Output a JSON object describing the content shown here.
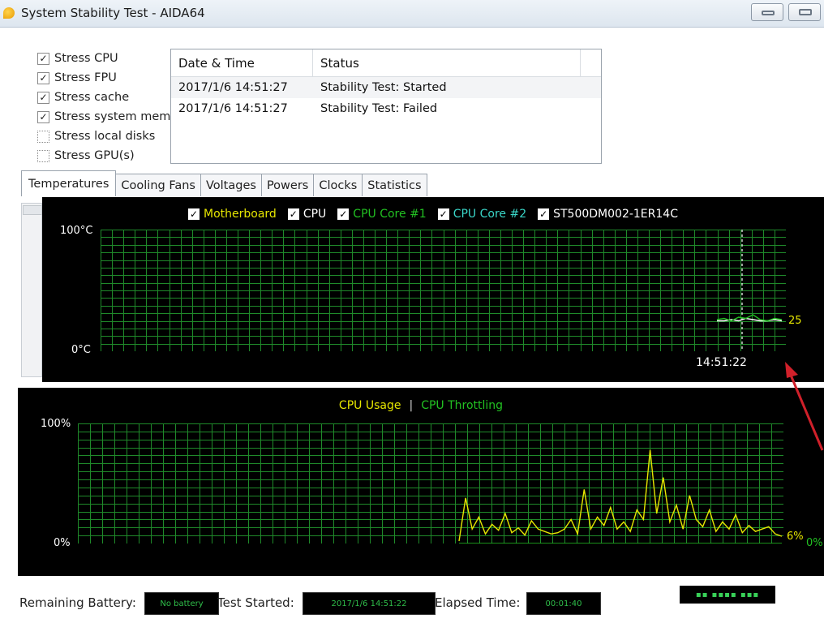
{
  "window": {
    "title": "System Stability Test - AIDA64",
    "icon": "aida64-flame-icon"
  },
  "stress_options": [
    {
      "label": "Stress CPU",
      "checked": true
    },
    {
      "label": "Stress FPU",
      "checked": true
    },
    {
      "label": "Stress cache",
      "checked": true
    },
    {
      "label": "Stress system mem",
      "checked": true
    },
    {
      "label": "Stress local disks",
      "checked": false
    },
    {
      "label": "Stress GPU(s)",
      "checked": false
    }
  ],
  "log": {
    "columns": [
      "Date & Time",
      "Status"
    ],
    "rows": [
      {
        "time": "2017/1/6 14:51:27",
        "status": "Stability Test: Started"
      },
      {
        "time": "2017/1/6 14:51:27",
        "status": "Stability Test: Failed"
      }
    ]
  },
  "tabs": [
    "Temperatures",
    "Cooling Fans",
    "Voltages",
    "Powers",
    "Clocks",
    "Statistics"
  ],
  "temperature_chart": {
    "legend": [
      {
        "label": "Motherboard",
        "color": "#e6e600",
        "checked": true
      },
      {
        "label": "CPU",
        "color": "#ffffff",
        "checked": true
      },
      {
        "label": "CPU Core #1",
        "color": "#22c022",
        "checked": true
      },
      {
        "label": "CPU Core #2",
        "color": "#3ad6c8",
        "checked": true
      },
      {
        "label": "ST500DM002-1ER14C",
        "color": "#ffffff",
        "checked": true
      }
    ],
    "y_max_label": "100°C",
    "y_min_label": "0°C",
    "current_value": "25",
    "marker_time": "14:51:22"
  },
  "cpu_chart": {
    "legend": [
      {
        "label": "CPU Usage",
        "color": "#e6e600"
      },
      {
        "label": "|",
        "color": "#cfcfcf"
      },
      {
        "label": "CPU Throttling",
        "color": "#22c022"
      }
    ],
    "y_max_label": "100%",
    "y_min_label": "0%",
    "usage_value": "6%",
    "throttling_value": "0%"
  },
  "chart_data": [
    {
      "type": "line",
      "title": "",
      "ylim": [
        0,
        100
      ],
      "ylabel": "",
      "series": [
        {
          "name": "CPU Core #1",
          "values": [
            26,
            27,
            25,
            28,
            27,
            30,
            26,
            25,
            27,
            26
          ]
        },
        {
          "name": "CPU",
          "values": [
            25,
            25,
            26,
            25,
            27,
            26,
            25,
            25,
            26,
            25
          ]
        }
      ]
    },
    {
      "type": "line",
      "title": "",
      "ylim": [
        0,
        100
      ],
      "series": [
        {
          "name": "CPU Usage",
          "values": [
            2,
            38,
            12,
            22,
            8,
            16,
            11,
            25,
            9,
            13,
            7,
            19,
            12,
            10,
            8,
            9,
            12,
            20,
            8,
            45,
            12,
            22,
            15,
            30,
            12,
            18,
            10,
            28,
            20,
            78,
            25,
            55,
            18,
            32,
            12,
            40,
            20,
            14,
            28,
            10,
            18,
            12,
            24,
            9,
            15,
            10,
            12,
            14,
            8,
            6
          ]
        },
        {
          "name": "CPU Throttling",
          "values": [
            0,
            0,
            0,
            0,
            0,
            0,
            0,
            0,
            0,
            0
          ]
        }
      ]
    }
  ],
  "status": {
    "battery_label": "Remaining Battery:",
    "battery_value": "No battery",
    "started_label": "Test Started:",
    "started_value": "2017/1/6 14:51:22",
    "elapsed_label": "Elapsed Time:",
    "elapsed_value": "00:01:40"
  }
}
